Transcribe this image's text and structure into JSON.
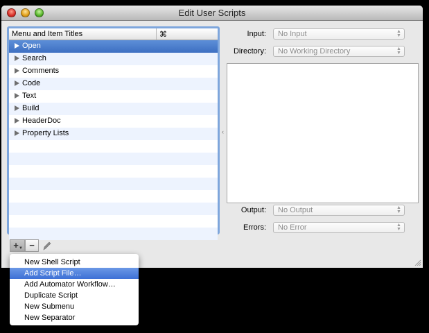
{
  "window": {
    "title": "Edit User Scripts"
  },
  "list": {
    "columns": {
      "title": "Menu and Item Titles",
      "key": "⌘"
    },
    "items": [
      {
        "label": "Open",
        "selected": true
      },
      {
        "label": "Search",
        "selected": false
      },
      {
        "label": "Comments",
        "selected": false
      },
      {
        "label": "Code",
        "selected": false
      },
      {
        "label": "Text",
        "selected": false
      },
      {
        "label": "Build",
        "selected": false
      },
      {
        "label": "HeaderDoc",
        "selected": false
      },
      {
        "label": "Property Lists",
        "selected": false
      }
    ]
  },
  "form": {
    "input": {
      "label": "Input:",
      "value": "No Input"
    },
    "directory": {
      "label": "Directory:",
      "value": "No Working Directory"
    },
    "output": {
      "label": "Output:",
      "value": "No Output"
    },
    "errors": {
      "label": "Errors:",
      "value": "No Error"
    }
  },
  "toolbar": {
    "add_glyph": "+",
    "remove_glyph": "−"
  },
  "menu": {
    "items": [
      {
        "label": "New Shell Script",
        "highlighted": false
      },
      {
        "label": "Add Script File…",
        "highlighted": true
      },
      {
        "label": "Add Automator Workflow…",
        "highlighted": false
      },
      {
        "label": "Duplicate Script",
        "highlighted": false
      },
      {
        "label": "New Submenu",
        "highlighted": false
      },
      {
        "label": "New Separator",
        "highlighted": false
      }
    ]
  },
  "colors": {
    "selection": "#3d6fc2",
    "list_focus_ring": "#7ea6dc",
    "menu_highlight": "#3d70d6"
  }
}
